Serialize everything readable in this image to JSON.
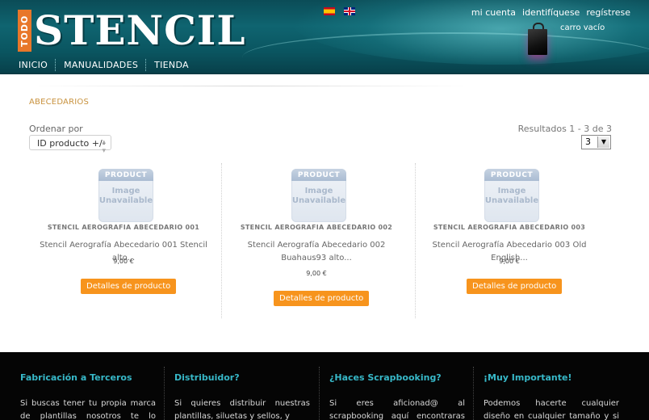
{
  "header": {
    "logo_small": "TODO",
    "logo_main": "STENCIL",
    "languages": [
      "es",
      "en"
    ],
    "links": [
      "mi cuenta",
      "identifíquese",
      "regístrese"
    ],
    "cart_text": "carro vacío",
    "nav": [
      "INICIO",
      "MANUALIDADES",
      "TIENDA"
    ],
    "bag_icon": "shopping-bag-icon"
  },
  "category": {
    "title": "ABECEDARIOS"
  },
  "sort": {
    "label": "Ordenar por",
    "selected": "ID producto +/-"
  },
  "results": {
    "text": "Resultados 1 - 3 de 3",
    "per_page": "3"
  },
  "placeholder": {
    "top": "PRODUCT",
    "line1": "Image",
    "line2": "Unavailable"
  },
  "products": [
    {
      "name": "STENCIL AEROGRAFIA ABECEDARIO 001",
      "desc": "Stencil Aerografía Abecedario 001 Stencil alto...",
      "price": "9,00 €",
      "button": "Detalles de producto"
    },
    {
      "name": "STENCIL AEROGRAFIA ABECEDARIO 002",
      "desc": "Stencil Aerografía Abecedario 002 Buahaus93 alto...",
      "price": "9,00 €",
      "button": "Detalles de producto"
    },
    {
      "name": "STENCIL AEROGRAFIA ABECEDARIO 003",
      "desc": "Stencil Aerografía Abecedario 003 Old English...",
      "price": "9,00 €",
      "button": "Detalles de producto"
    }
  ],
  "footer": [
    {
      "title": "Fabricación a Terceros",
      "text": "Si buscas tener tu propia marca de plantillas nosotros te lo ponemos"
    },
    {
      "title": "Distribuidor?",
      "text": "Si quieres distribuir nuestras plantillas, siluetas y sellos, y"
    },
    {
      "title": "¿Haces Scrapbooking?",
      "text": "Si eres aficionad@ al scrapbooking aquí encontraras infinidad de"
    },
    {
      "title": "¡Muy Importante!",
      "text": "Podemos hacerte cualquier diseño en cualquier tamaño y si no"
    }
  ],
  "colors": {
    "header_teal": "#0f6470",
    "accent_orange": "#f7941d",
    "section_title": "#c8923e",
    "footer_title": "#37b8c8",
    "footer_bg": "#050505"
  }
}
